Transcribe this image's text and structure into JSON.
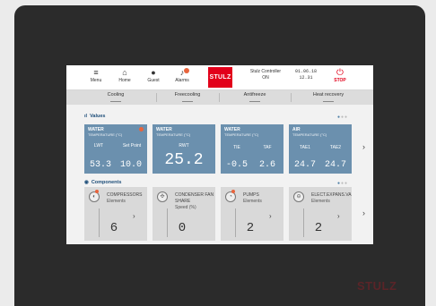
{
  "topbar": {
    "nav": [
      {
        "label": "Menu",
        "icon": "menu-icon",
        "glyph": "≡"
      },
      {
        "label": "Home",
        "icon": "home-icon",
        "glyph": "⌂"
      },
      {
        "label": "Guest",
        "icon": "user-icon",
        "glyph": "●"
      },
      {
        "label": "Alarms",
        "icon": "bell-icon",
        "glyph": "♪"
      }
    ],
    "logo": "STULZ",
    "status_line1": "Stulz Controller",
    "status_line2": "ON",
    "date": "01.06.18",
    "time": "12.31",
    "stop_label": "STOP",
    "stop_glyph": "⏻"
  },
  "tabs": [
    "Cooling",
    "Freecooling",
    "Antifreeze",
    "Heat recovery"
  ],
  "values_section": {
    "title": "Values",
    "icon_glyph": "ıl",
    "cards": [
      {
        "title": "WATER",
        "unit": "TEMPERATURE (°C)",
        "labels": [
          "LWT",
          "Set Point"
        ],
        "values": [
          "53.3",
          "10.0"
        ],
        "alert": true
      },
      {
        "title": "WATER",
        "unit": "TEMPERATURE (°C)",
        "labels": [
          "RWT"
        ],
        "values": [
          "25.2"
        ],
        "alert": false
      },
      {
        "title": "WATER",
        "unit": "TEMPERATURE (°C)",
        "labels": [
          "TIE",
          "TAF"
        ],
        "values": [
          "-0.5",
          "2.6"
        ],
        "alert": false
      },
      {
        "title": "AIR",
        "unit": "TEMPERATURE (°C)",
        "labels": [
          "TAE1",
          "TAE2"
        ],
        "values": [
          "24.7",
          "24.7"
        ],
        "alert": false
      }
    ]
  },
  "components_section": {
    "title": "Components",
    "icon_glyph": "◉",
    "cards": [
      {
        "name": "COMPRESSORS",
        "sub": "Elements",
        "value": "6",
        "glyph": "◐",
        "alert": true
      },
      {
        "name": "CONDENSER FAN SHARE",
        "sub": "Speed (%)",
        "value": "0",
        "glyph": "✣",
        "alert": false
      },
      {
        "name": "PUMPS",
        "sub": "Elements",
        "value": "2",
        "glyph": "◔",
        "alert": true
      },
      {
        "name": "ELECT.EXPANS.VA",
        "sub": "Elements",
        "value": "2",
        "glyph": "⊖",
        "alert": false
      }
    ]
  },
  "bezel_brand": "STULZ",
  "colors": {
    "card_blue": "#6b90ae",
    "alert": "#e8643c",
    "brand_red": "#e2001a",
    "bezel": "#2b2b2b"
  }
}
